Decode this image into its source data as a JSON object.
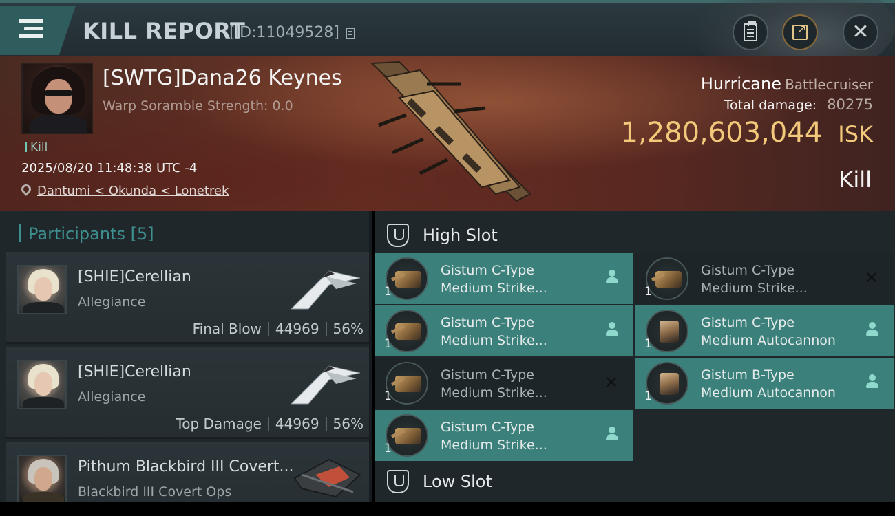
{
  "header": {
    "title": "KILL REPORT",
    "report_id": "[ID:11049528]"
  },
  "victim": {
    "name": "[SWTG]Dana26 Keynes",
    "warp_scramble": "Warp Soramble Strength: 0.0",
    "kill_tag": "Kill",
    "datetime": "2025/08/20 11:48:38 UTC -4",
    "location": "Dantumi < Okunda < Lonetrek",
    "ship_name": "Hurricane",
    "ship_class": "Battlecruiser",
    "total_damage_label": "Total damage:",
    "total_damage": "80275",
    "isk_value": "1,280,603,044",
    "isk_unit": "ISK",
    "result": "Kill"
  },
  "participants": {
    "header": "Participants [5]",
    "items": [
      {
        "name": "[SHIE]Cerellian",
        "sub": "Allegiance",
        "role": "Final Blow",
        "damage": "44969",
        "percent": "56%",
        "portrait": "female-blonde",
        "ship_icon": "white-frigate-icon"
      },
      {
        "name": "[SHIE]Cerellian",
        "sub": "Allegiance",
        "role": "Top Damage",
        "damage": "44969",
        "percent": "56%",
        "portrait": "female-blonde",
        "ship_icon": "white-frigate-icon"
      },
      {
        "name": "Pithum Blackbird III Covert...",
        "sub": "Blackbird III Covert Ops",
        "portrait": "male-grey",
        "ship_icon": "dark-cruiser-icon"
      }
    ]
  },
  "slots": {
    "high_slot_label": "High Slot",
    "low_slot_label": "Low Slot",
    "high_modules": [
      {
        "line1": "Gistum C-Type",
        "line2": "Medium Strike...",
        "qty": "1",
        "state": "fitted",
        "icon": "torpedo-launcher-icon"
      },
      {
        "line1": "Gistum C-Type",
        "line2": "Medium Strike...",
        "qty": "1",
        "state": "destroyed",
        "icon": "torpedo-launcher-icon"
      },
      {
        "line1": "Gistum C-Type",
        "line2": "Medium Strike...",
        "qty": "1",
        "state": "fitted",
        "icon": "torpedo-launcher-icon"
      },
      {
        "line1": "Gistum C-Type",
        "line2": "Medium Autocannon",
        "qty": "1",
        "state": "fitted",
        "icon": "autocannon-icon"
      },
      {
        "line1": "Gistum C-Type",
        "line2": "Medium Strike...",
        "qty": "1",
        "state": "destroyed",
        "icon": "torpedo-launcher-icon"
      },
      {
        "line1": "Gistum B-Type",
        "line2": "Medium Autocannon",
        "qty": "1",
        "state": "fitted",
        "icon": "autocannon-icon"
      },
      {
        "line1": "Gistum C-Type",
        "line2": "Medium Strike...",
        "qty": "1",
        "state": "fitted",
        "icon": "torpedo-launcher-icon"
      }
    ]
  },
  "colors": {
    "accent_teal": "#3b807a",
    "isk_gold": "#f2c87a",
    "banner_red": "#6a3426"
  }
}
